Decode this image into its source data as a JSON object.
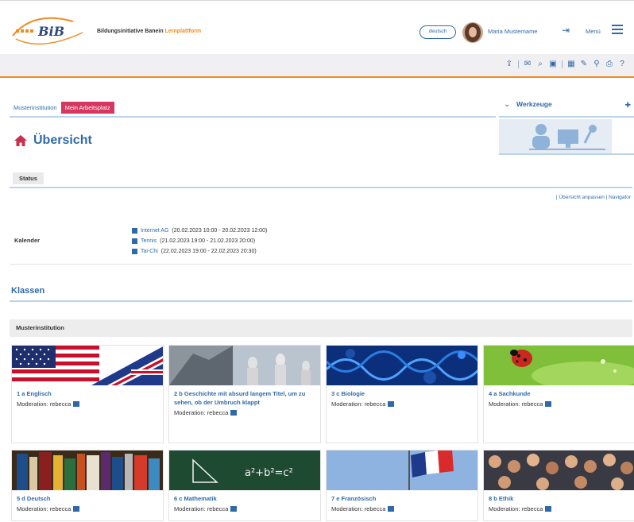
{
  "header": {
    "logo_text": "BiB",
    "initiative_text": "Bildungsinitiative Banein",
    "initiative_suffix": "Lernplattform",
    "language_button": "deutsch",
    "user_name": "Maria Mustername",
    "menu_label": "Menü"
  },
  "tabs": [
    {
      "label": "Musterinstitution",
      "active": false
    },
    {
      "label": "Mein Arbeitsplatz",
      "active": true
    }
  ],
  "werkzeuge": {
    "title": "Werkzeuge"
  },
  "page": {
    "title": "Übersicht"
  },
  "status": {
    "tab_label": "Status",
    "view_links": "| Übersicht anpassen | Navigator"
  },
  "kalender": {
    "label": "Kalender",
    "items": [
      {
        "name": "Internet AG",
        "time": "(20.02.2023 10:00 - 20.02.2023 12:00)"
      },
      {
        "name": "Tennis",
        "time": "(21.02.2023 19:00 - 21.02.2023 20:00)"
      },
      {
        "name": "Tai-Chi",
        "time": "(22.02.2023 19:00 - 22.02.2023 20:30)"
      }
    ]
  },
  "klassen": {
    "title": "Klassen"
  },
  "institution": {
    "label": "Musterinstitution"
  },
  "classes": [
    {
      "name": "1 a Englisch",
      "moderation": "Moderation: rebecca",
      "image": "flags-us-uk"
    },
    {
      "name": "2 b Geschichte mit absurd langem Titel, um zu sehen, ob der Umbruch klappt",
      "moderation": "Moderation: rebecca",
      "image": "statues"
    },
    {
      "name": "3 c Biologie",
      "moderation": "Moderation: rebecca",
      "image": "dna"
    },
    {
      "name": "4 a Sachkunde",
      "moderation": "Moderation: rebecca",
      "image": "ladybug"
    },
    {
      "name": "5 d Deutsch",
      "moderation": "Moderation: rebecca",
      "image": "books"
    },
    {
      "name": "6 c Mathematik",
      "moderation": "Moderation: rebecca",
      "image": "chalkboard"
    },
    {
      "name": "7 e Französisch",
      "moderation": "Moderation: rebecca",
      "image": "flag-fr"
    },
    {
      "name": "8 b Ethik",
      "moderation": "Moderation: rebecca",
      "image": "crowd"
    }
  ],
  "colors": {
    "brand_blue": "#2f6aa8",
    "accent_orange": "#f08a24",
    "active_tab": "#d63660"
  }
}
